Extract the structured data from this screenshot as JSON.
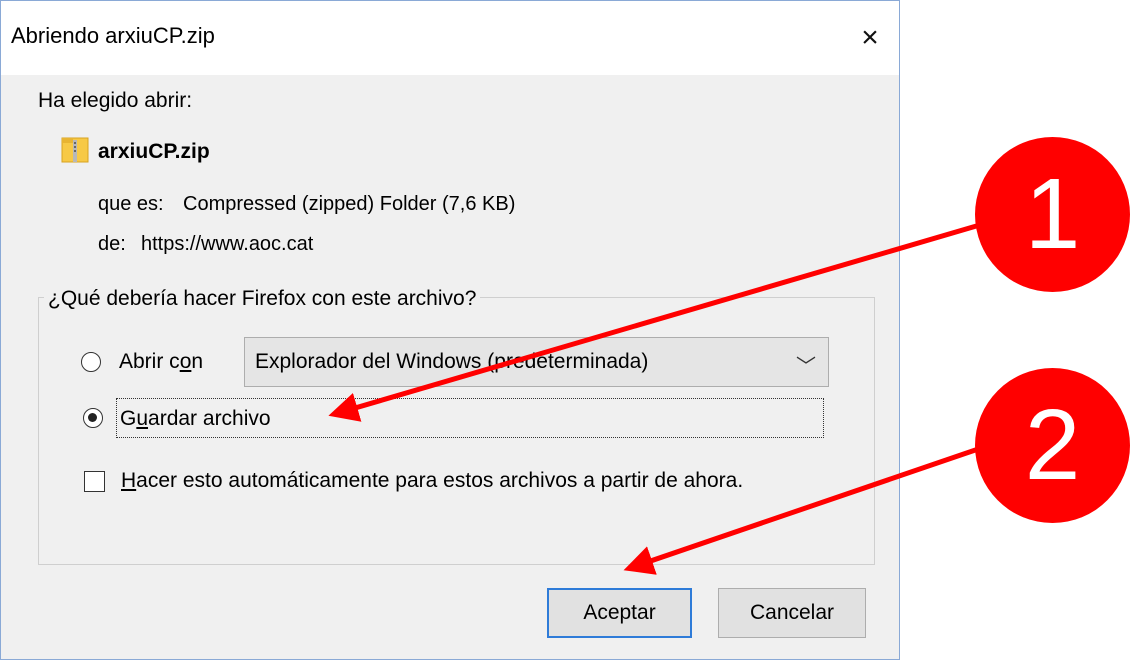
{
  "dialog": {
    "title": "Abriendo arxiuCP.zip",
    "close_icon": "×",
    "intro": "Ha elegido abrir:",
    "file": {
      "name": "arxiuCP.zip",
      "icon": "zip-folder-icon",
      "type_label": "que es:",
      "type_value": "Compressed (zipped) Folder (7,6 KB)",
      "from_label": "de:",
      "from_value": "https://www.aoc.cat"
    },
    "question": "¿Qué debería hacer Firefox con este archivo?",
    "options": {
      "open_with": {
        "label_a": "Abrir c",
        "label_u": "o",
        "label_b": "n",
        "selected": false,
        "app": "Explorador del Windows (predeterminada)"
      },
      "save": {
        "label_a": "G",
        "label_u": "u",
        "label_b": "ardar archivo",
        "selected": true
      }
    },
    "auto_checkbox": {
      "label_u": "H",
      "label_b": "acer esto automáticamente para estos archivos a partir de ahora.",
      "checked": false
    },
    "buttons": {
      "accept": "Aceptar",
      "cancel": "Cancelar"
    }
  },
  "annotations": {
    "badge_1": "1",
    "badge_2": "2",
    "color": "#ff0000"
  }
}
